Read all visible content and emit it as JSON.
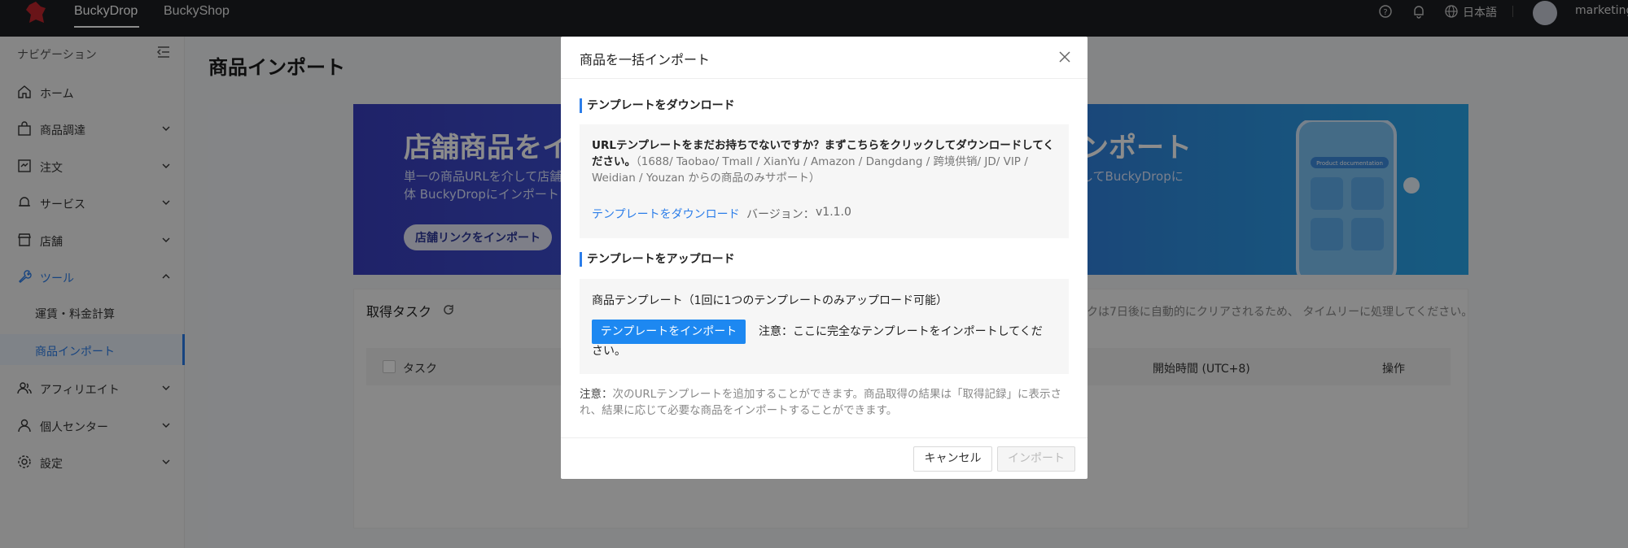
{
  "topbar": {
    "tabs": [
      {
        "label": "BuckyDrop"
      },
      {
        "label": "BuckyShop"
      }
    ],
    "language": "日本語",
    "user": "marketing"
  },
  "sidebar": {
    "title": "ナビゲーション",
    "items": [
      {
        "label": "ホーム",
        "icon": "home-icon"
      },
      {
        "label": "商品調達",
        "icon": "bag-icon"
      },
      {
        "label": "注文",
        "icon": "order-icon"
      },
      {
        "label": "サービス",
        "icon": "service-icon"
      },
      {
        "label": "店舗",
        "icon": "store-icon"
      },
      {
        "label": "ツール",
        "icon": "wrench-icon"
      },
      {
        "label": "アフィリエイト",
        "icon": "affiliate-icon"
      },
      {
        "label": "個人センター",
        "icon": "user-icon"
      },
      {
        "label": "設定",
        "icon": "gear-icon"
      }
    ],
    "tool_sub_items": [
      {
        "label": "運賃・料金計算"
      },
      {
        "label": "商品インポート"
      }
    ]
  },
  "main": {
    "page_title": "商品インポート",
    "banner": {
      "title": "店舗商品をイン",
      "desc": "単一の商品URLを介して店舗全体 BuckyDropにインポート",
      "button": "店舗リンクをインポート",
      "title2": "ンポート",
      "desc2": "してBuckyDropに",
      "phone_label": "Product documentation"
    },
    "task": {
      "title": "取得タスク",
      "note": "クは7日後に自動的にクリアされるため、 タイムリーに処理してください。",
      "columns": {
        "task": "タスク",
        "start": "開始時間 (UTC+8)",
        "op": "操作"
      }
    }
  },
  "modal": {
    "title": "商品を一括インポート",
    "download_section": "テンプレートをダウンロード",
    "download_text_bold": "URLテンプレートをまだお持ちでないですか？まずこちらをクリックしてダウンロードしてください。",
    "download_text_muted": "（1688/ Taobao/ Tmall / XianYu / Amazon / Dangdang / 跨境供销/ JD/ VIP / Weidian / Youzan からの商品のみサポート）",
    "download_link": "テンプレートをダウンロード",
    "version_label": "バージョン：",
    "version_value": "v1.1.0",
    "upload_section": "テンプレートをアップロード",
    "upload_label": "商品テンプレート（1回に1つのテンプレートのみアップロード可能）",
    "import_template_button": "テンプレートをインポート",
    "upload_note": "注意：ここに完全なテンプレートをインポートしてください。",
    "foot_note_label": "注意：",
    "foot_note_text": "次のURLテンプレートを追加することができます。商品取得の結果は「取得記録」に表示され、結果に応じて必要な商品をインポートすることができます。",
    "cancel_button": "キャンセル",
    "import_button": "インポート"
  },
  "colors": {
    "accent": "#1d88f1",
    "topbar": "#1c1e22"
  }
}
